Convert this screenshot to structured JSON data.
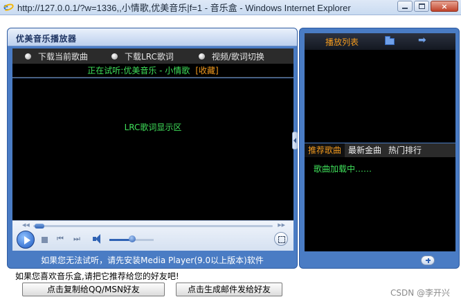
{
  "window": {
    "title": "http://127.0.0.1/?w=1336,,小情歌,优美音乐|f=1 - 音乐盒 - Windows Internet Explorer",
    "close_label": "×"
  },
  "player": {
    "title": "优美音乐播放器",
    "options": [
      {
        "label": "下载当前歌曲"
      },
      {
        "label": "下载LRC歌词"
      },
      {
        "label": "视频/歌词切换"
      }
    ],
    "now_playing": "正在试听:优美音乐 - 小情歌",
    "favorite_label": "[收藏]",
    "lrc_placeholder": "LRC歌词显示区",
    "seek_left": "◀◀",
    "seek_right": "▶▶",
    "prev_label": "⏮",
    "next_label": "⏭",
    "footer_note": "如果您无法试听，请先安装Media Player(9.0以上版本)软件"
  },
  "side": {
    "playlist_title": "播放列表",
    "arrow_label": "➡",
    "tabs": [
      {
        "label": "推荐歌曲",
        "active": true
      },
      {
        "label": "最新金曲",
        "active": false
      },
      {
        "label": "热门排行",
        "active": false
      }
    ],
    "loading_text": "歌曲加载中……"
  },
  "bottom": {
    "hint": "如果您喜欢音乐盒,请把它推荐给您的好友吧!",
    "copy_button": "点击复制给QQ/MSN好友",
    "email_button": "点击生成邮件发给好友"
  },
  "watermark": "CSDN @李开兴",
  "colors": {
    "accent_green": "#3fe05a",
    "accent_orange": "#f29a1e",
    "panel_blue": "#4a7cc4"
  },
  "icons": [
    "ie-icon",
    "minimize-icon",
    "maximize-icon",
    "close-icon",
    "radio-icon",
    "play-icon",
    "stop-icon",
    "previous-icon",
    "next-icon",
    "volume-icon",
    "fullscreen-icon",
    "folder-icon",
    "arrow-right-icon",
    "add-icon",
    "chevron-left-icon"
  ]
}
